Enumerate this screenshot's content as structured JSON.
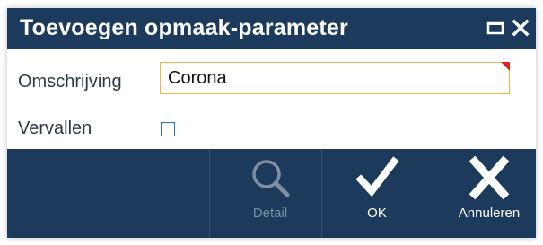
{
  "dialog": {
    "title": "Toevoegen opmaak-parameter",
    "controls": {
      "maximize_icon": "maximize-icon",
      "close_icon": "close-icon"
    }
  },
  "form": {
    "omschrijving": {
      "label": "Omschrijving",
      "value": "Corona",
      "required": true
    },
    "vervallen": {
      "label": "Vervallen",
      "checked": false
    }
  },
  "toolbar": {
    "detail": {
      "label": "Detail",
      "icon": "magnifier-icon",
      "enabled": false
    },
    "ok": {
      "label": "OK",
      "icon": "checkmark-icon",
      "enabled": true
    },
    "annuleren": {
      "label": "Annuleren",
      "icon": "x-cancel-icon",
      "enabled": true
    }
  },
  "colors": {
    "titlebar": "#1b3a5c",
    "toolbar": "#1b3a5c",
    "input_border_focus": "#f0b34a",
    "required_marker": "#e0231e",
    "checkbox_border": "#1f70c8",
    "disabled_icon": "#7e8fa3"
  }
}
